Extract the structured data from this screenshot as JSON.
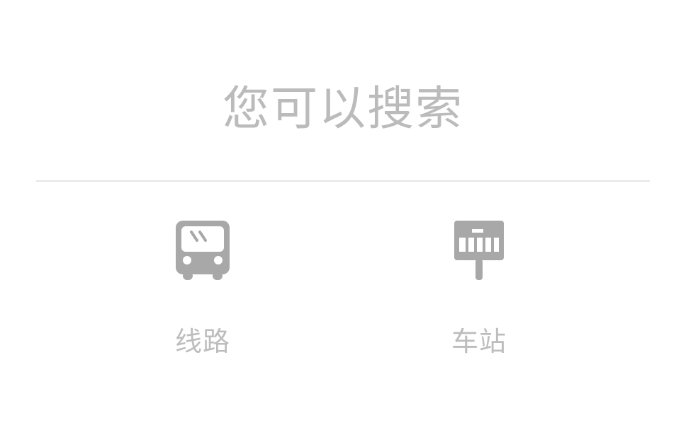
{
  "header": {
    "title": "您可以搜索"
  },
  "options": [
    {
      "label": "线路",
      "icon": "bus-icon"
    },
    {
      "label": "车站",
      "icon": "bus-stop-sign-icon"
    }
  ],
  "colors": {
    "icon": "#a8a8a8",
    "text": "#bbbbbb",
    "divider": "#e6e6e6",
    "background": "#ffffff"
  }
}
